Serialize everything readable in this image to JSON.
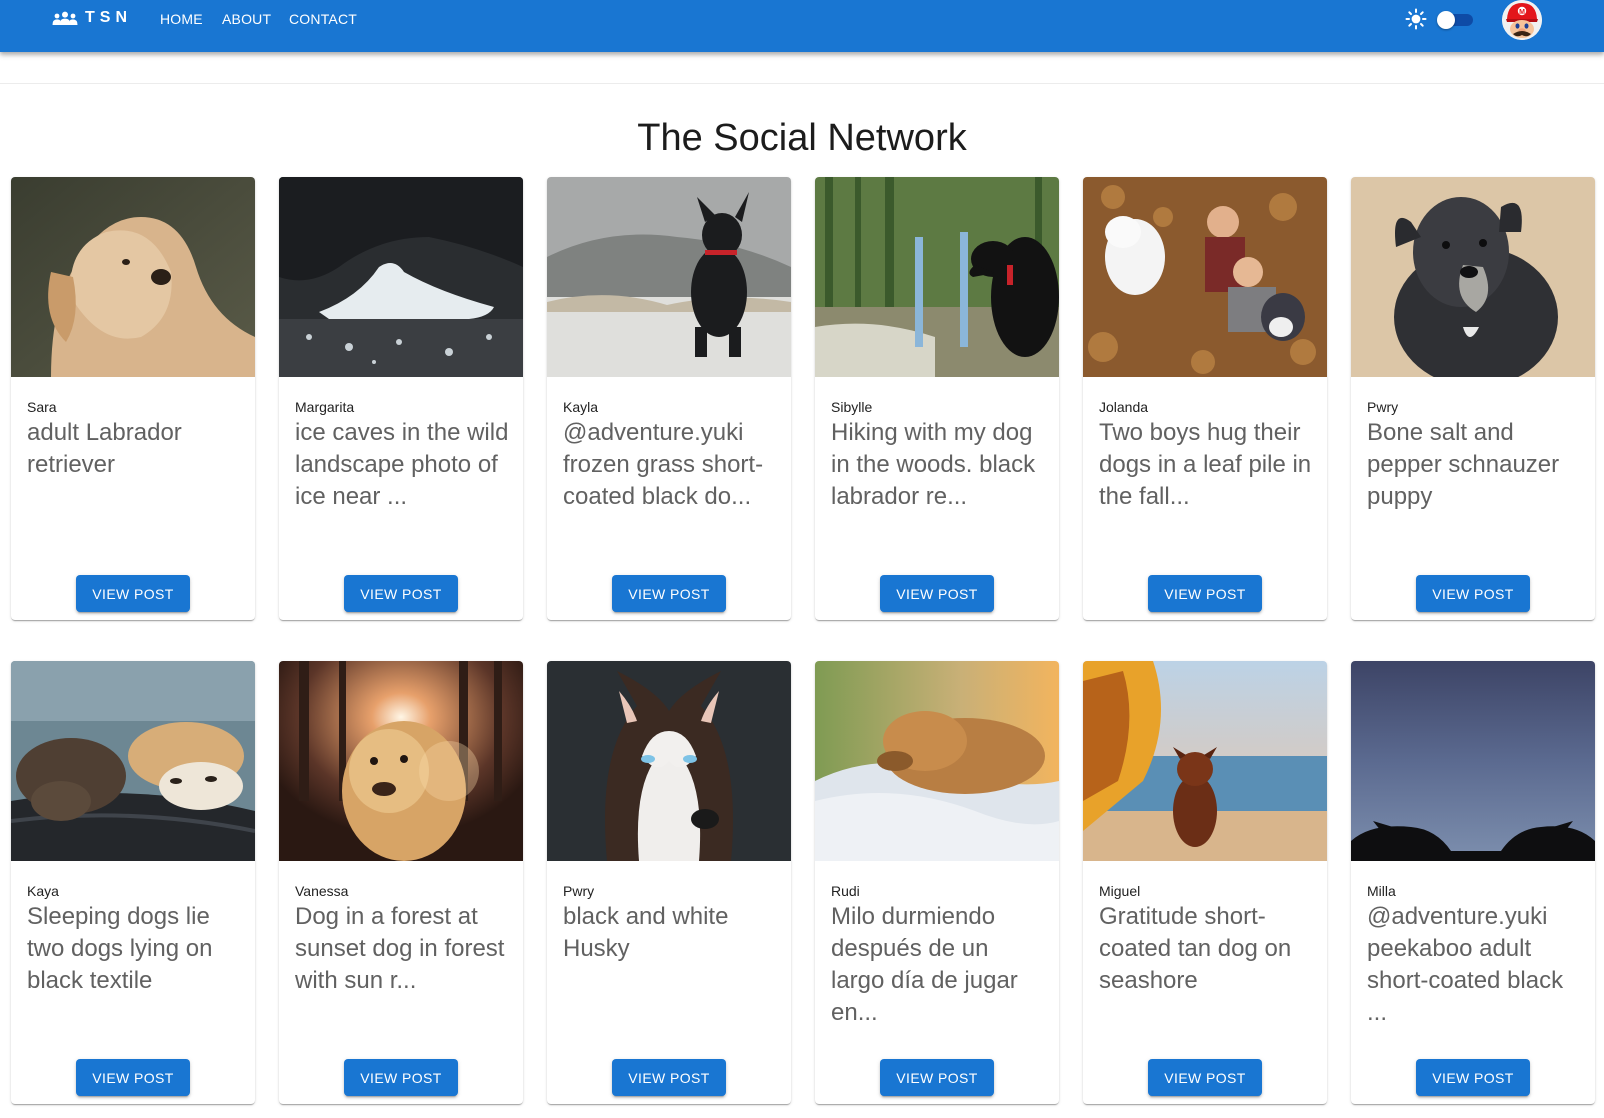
{
  "app": {
    "logo_text": "TSN",
    "logo_icon": "groups-icon"
  },
  "nav": {
    "home": "HOME",
    "about": "ABOUT",
    "contact": "CONTACT"
  },
  "header": {
    "theme_icon": "sun-icon",
    "avatar_icon": "mario-avatar"
  },
  "page": {
    "title": "The Social Network"
  },
  "button_label": "VIEW POST",
  "colors": {
    "primary": "#1976d2",
    "text_secondary": "#616161",
    "background": "#ffffff"
  },
  "posts": [
    {
      "author": "Sara",
      "description": "adult Labrador retriever"
    },
    {
      "author": "Margarita",
      "description": "ice caves in the wild landscape photo of ice near ..."
    },
    {
      "author": "Kayla",
      "description": "@adventure.yuki frozen grass short-coated black do..."
    },
    {
      "author": "Sibylle",
      "description": "Hiking with my dog in the woods. black labrador re..."
    },
    {
      "author": "Jolanda",
      "description": "Two boys hug their dogs in a leaf pile in the fall..."
    },
    {
      "author": "Pwry",
      "description": "Bone salt and pepper schnauzer puppy"
    },
    {
      "author": "Kaya",
      "description": "Sleeping dogs lie two dogs lying on black textile"
    },
    {
      "author": "Vanessa",
      "description": "Dog in a forest at sunset dog in forest with sun r..."
    },
    {
      "author": "Pwry",
      "description": "black and white Husky"
    },
    {
      "author": "Rudi",
      "description": "Milo durmiendo después de un largo día de jugar en..."
    },
    {
      "author": "Miguel",
      "description": "Gratitude short-coated tan dog on seashore"
    },
    {
      "author": "Milla",
      "description": "@adventure.yuki peekaboo adult short-coated black ..."
    }
  ]
}
